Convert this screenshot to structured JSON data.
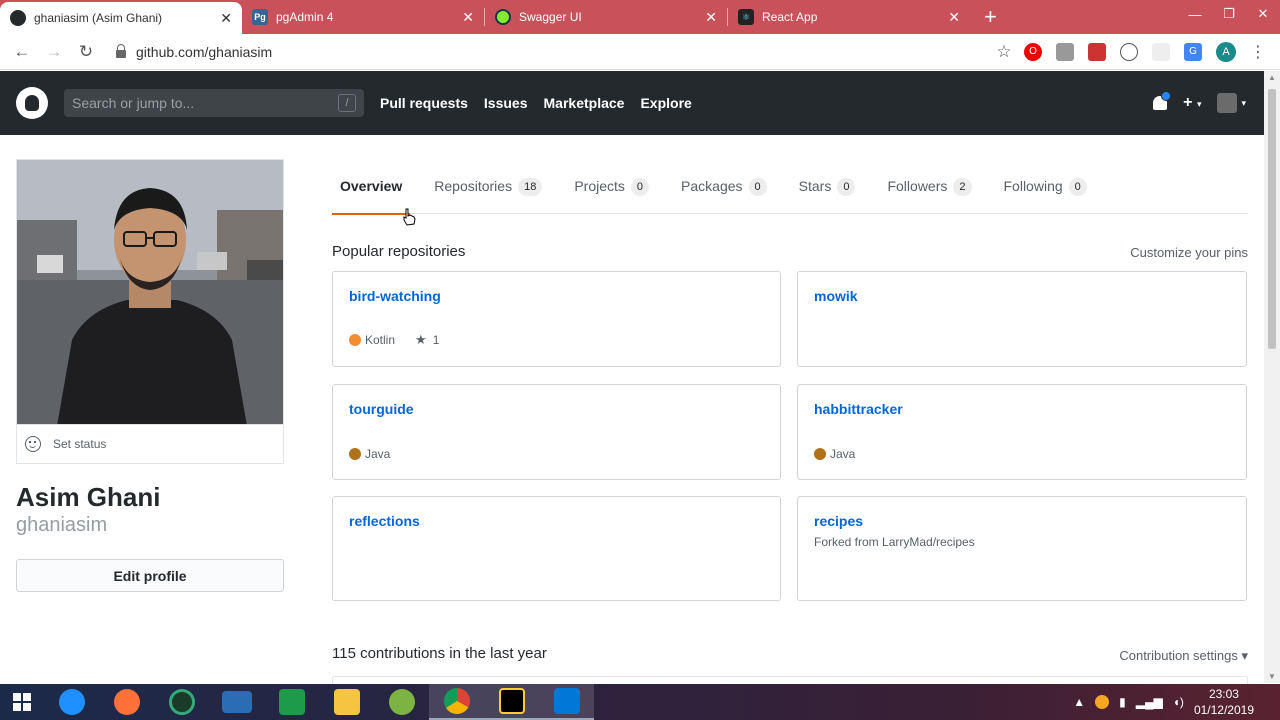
{
  "browser": {
    "tabs": [
      {
        "title": "ghaniasim (Asim Ghani)",
        "active": true,
        "icon": "github-icon",
        "color": "#24292e"
      },
      {
        "title": "pgAdmin 4",
        "active": false,
        "icon": "pgadmin-icon",
        "color": "#336791",
        "glyph": "Pg"
      },
      {
        "title": "Swagger UI",
        "active": false,
        "icon": "swagger-icon",
        "color": "#85ea2d"
      },
      {
        "title": "React App",
        "active": false,
        "icon": "react-icon",
        "color": "#222"
      }
    ],
    "url": "github.com/ghaniasim"
  },
  "header": {
    "search_placeholder": "Search or jump to...",
    "search_shortcut": "/",
    "nav": [
      "Pull requests",
      "Issues",
      "Marketplace",
      "Explore"
    ],
    "plus": "+"
  },
  "profile": {
    "status": "Set status",
    "fullname": "Asim Ghani",
    "username": "ghaniasim",
    "edit_label": "Edit profile"
  },
  "tabs": [
    {
      "label": "Overview",
      "count": null,
      "selected": true
    },
    {
      "label": "Repositories",
      "count": "18"
    },
    {
      "label": "Projects",
      "count": "0"
    },
    {
      "label": "Packages",
      "count": "0"
    },
    {
      "label": "Stars",
      "count": "0"
    },
    {
      "label": "Followers",
      "count": "2"
    },
    {
      "label": "Following",
      "count": "0"
    }
  ],
  "popular": {
    "title": "Popular repositories",
    "customize": "Customize your pins",
    "repos": [
      {
        "name": "bird-watching",
        "lang": "Kotlin",
        "lang_color": "#F18E33",
        "stars": "1"
      },
      {
        "name": "mowik"
      },
      {
        "name": "tourguide",
        "lang": "Java",
        "lang_color": "#b07219"
      },
      {
        "name": "habbittracker",
        "lang": "Java",
        "lang_color": "#b07219"
      },
      {
        "name": "reflections"
      },
      {
        "name": "recipes",
        "forked": "Forked from LarryMad/recipes"
      }
    ]
  },
  "contributions": {
    "title": "115 contributions in the last year",
    "settings": "Contribution settings ▾"
  },
  "taskbar": {
    "time": "23:03",
    "date": "01/12/2019"
  }
}
